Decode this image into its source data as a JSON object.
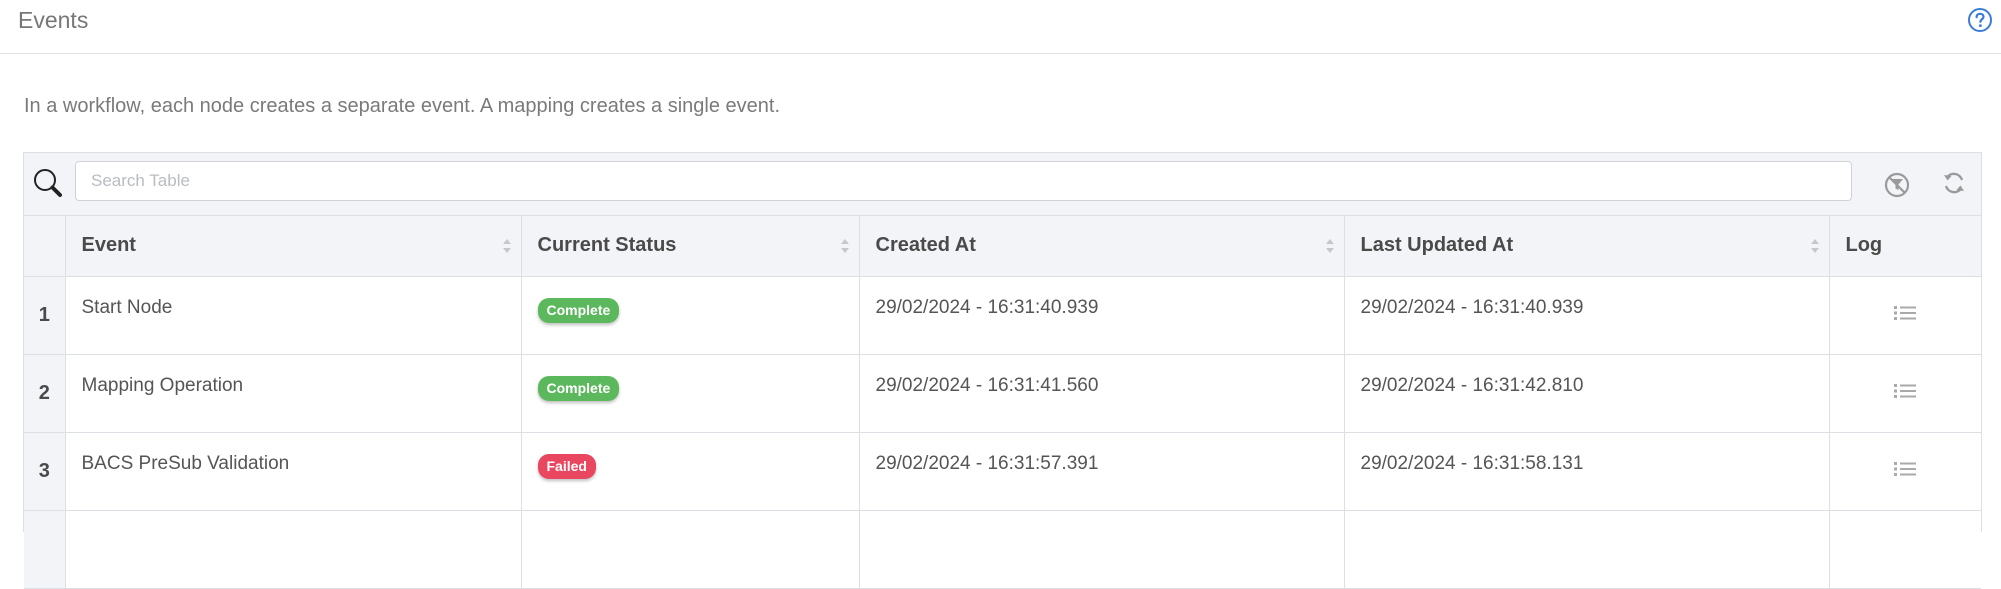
{
  "header": {
    "title": "Events",
    "help_icon": "question-circle-icon"
  },
  "description": "In a workflow, each node creates a separate event. A mapping creates a single event.",
  "toolbar": {
    "search_placeholder": "Search Table",
    "search_value": "",
    "search_icon": "search-icon",
    "filter_icon": "clear-filter-icon",
    "refresh_icon": "refresh-icon"
  },
  "table": {
    "columns": [
      "Event",
      "Current Status",
      "Created At",
      "Last Updated At",
      "Log"
    ],
    "rows": [
      {
        "num": "1",
        "event": "Start Node",
        "status": "Complete",
        "status_color": "#5cb85c",
        "created": "29/02/2024 - 16:31:40.939",
        "updated": "29/02/2024 - 16:31:40.939"
      },
      {
        "num": "2",
        "event": "Mapping Operation",
        "status": "Complete",
        "status_color": "#5cb85c",
        "created": "29/02/2024 - 16:31:41.560",
        "updated": "29/02/2024 - 16:31:42.810"
      },
      {
        "num": "3",
        "event": "BACS PreSub Validation",
        "status": "Failed",
        "status_color": "#e8475f",
        "created": "29/02/2024 - 16:31:57.391",
        "updated": "29/02/2024 - 16:31:58.131"
      }
    ]
  },
  "colors": {
    "accent": "#3a7dd8",
    "complete": "#5cb85c",
    "failed": "#e8475f",
    "header_bg": "#f3f4f7",
    "border": "#dcdfe4"
  }
}
